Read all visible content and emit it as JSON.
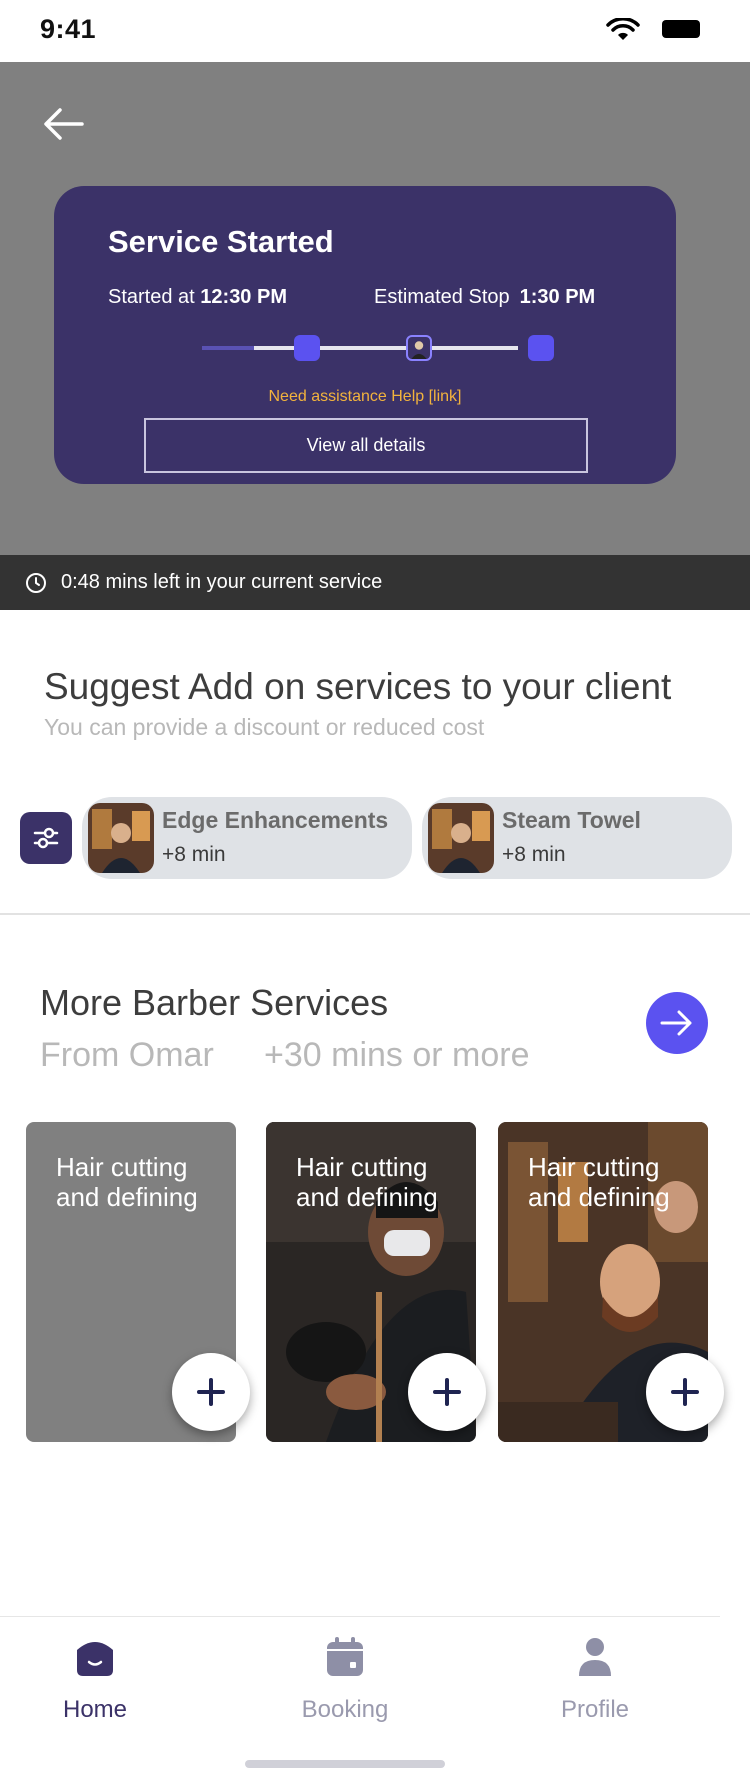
{
  "status_bar": {
    "time": "9:41"
  },
  "service_card": {
    "title": "Service Started",
    "started_prefix": "Started at",
    "started_time": "12:30 PM",
    "stop_prefix": "Estimated Stop",
    "stop_time": "1:30 PM",
    "help_text": "Need assistance Help [link]",
    "details_button": "View all details"
  },
  "time_banner": {
    "text": "0:48 mins left in your current service",
    "icon": "clock-icon"
  },
  "suggest": {
    "title": "Suggest Add on services to your client",
    "subtitle": "You can provide a discount or reduced cost",
    "chips": [
      {
        "title": "Edge Enhancements",
        "duration": "+8 min"
      },
      {
        "title": "Steam Towel",
        "duration": "+8 min"
      }
    ]
  },
  "more": {
    "title": "More Barber Services",
    "from": "From Omar",
    "time": "+30 mins or more",
    "cards": [
      {
        "label": "Hair cutting and defining"
      },
      {
        "label": "Hair cutting and defining"
      },
      {
        "label": "Hair cutting and defining"
      }
    ]
  },
  "tabs": [
    {
      "label": "Home",
      "icon": "home-icon",
      "active": true
    },
    {
      "label": "Booking",
      "icon": "calendar-icon",
      "active": false
    },
    {
      "label": "Profile",
      "icon": "profile-icon",
      "active": false
    }
  ],
  "colors": {
    "primary": "#3b3268",
    "accent": "#5b52f0",
    "help_link": "#f2b33d",
    "header_bg": "#808080",
    "banner_bg": "#333333"
  }
}
